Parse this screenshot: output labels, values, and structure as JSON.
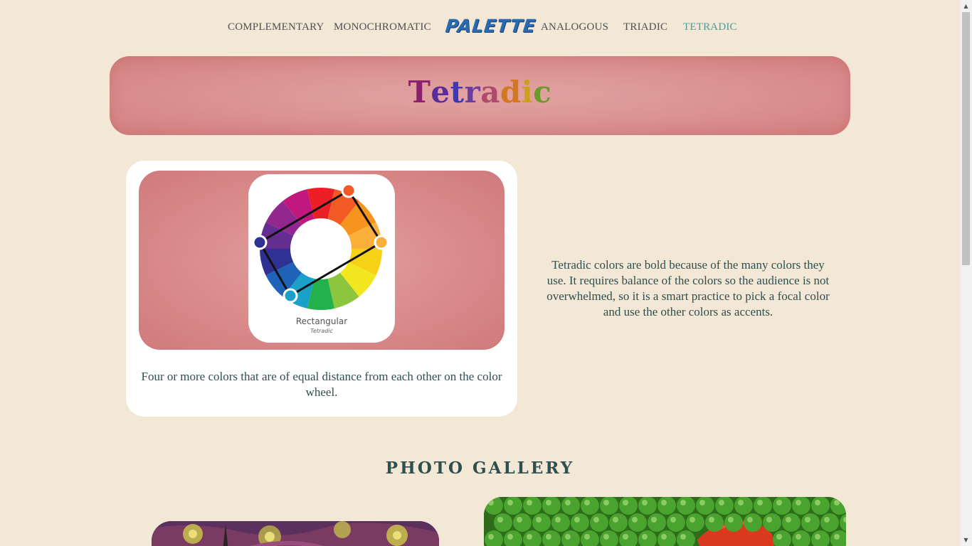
{
  "nav": {
    "items": [
      {
        "label": "COMPLEMENTARY",
        "active": false
      },
      {
        "label": "MONOCHROMATIC",
        "active": false
      },
      {
        "label": "ANALOGOUS",
        "active": false
      },
      {
        "label": "TRIADIC",
        "active": false
      },
      {
        "label": "TETRADIC",
        "active": true
      }
    ],
    "logo": "PALETTE"
  },
  "hero": {
    "title": "Tetradic",
    "letter_colors": [
      "#8a1f6e",
      "#5b2d9b",
      "#3a3ab8",
      "#6b3fa0",
      "#b04a6a",
      "#d4781f",
      "#c9a21a",
      "#6a9a2a"
    ]
  },
  "card": {
    "wheel_title": "Rectangular",
    "wheel_subtitle": "Tetradic",
    "caption": "Four or more colors that are of equal distance from each other on the color wheel."
  },
  "description": "Tetradic colors are bold because of the many colors they use. It requires balance of the colors so the audience is not overwhelmed, so it is a smart practice to pick a focal color and use the other colors as accents.",
  "gallery": {
    "title": "PHOTO GALLERY"
  },
  "colors": {
    "background": "#f3e7d6",
    "hero": "#d98f8f",
    "active_nav": "#4f9a95",
    "text": "#2f4f4f",
    "logo": "#2a6bb0"
  },
  "icons": {
    "scroll_up": "triangle-up",
    "scroll_down": "triangle-down"
  }
}
